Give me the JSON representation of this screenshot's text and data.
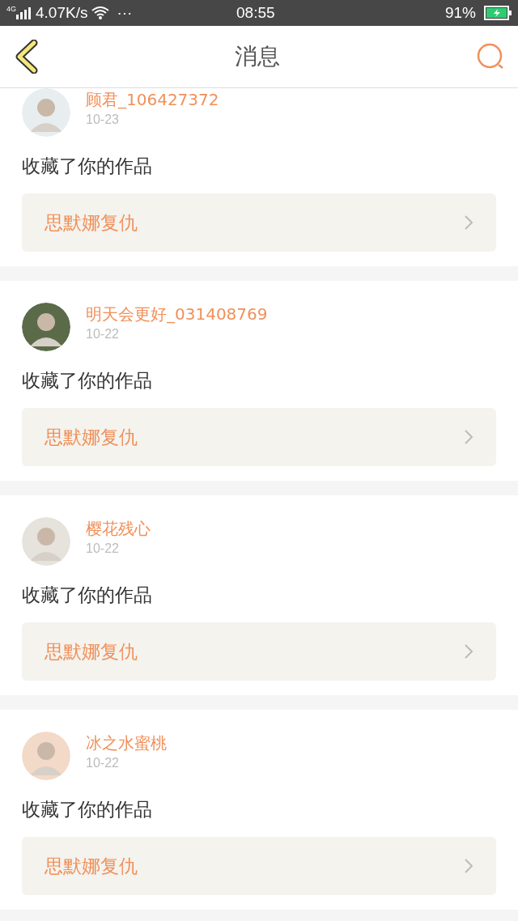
{
  "status_bar": {
    "network": "4G",
    "speed": "4.07K/s",
    "more": "···",
    "time": "08:55",
    "battery": "91%"
  },
  "header": {
    "title": "消息"
  },
  "messages": [
    {
      "user": "顾君_106427372",
      "date": "10-23",
      "action": "收藏了你的作品",
      "work": "思默娜复仇"
    },
    {
      "user": "明天会更好_031408769",
      "date": "10-22",
      "action": "收藏了你的作品",
      "work": "思默娜复仇"
    },
    {
      "user": "樱花残心",
      "date": "10-22",
      "action": "收藏了你的作品",
      "work": "思默娜复仇"
    },
    {
      "user": "冰之水蜜桃",
      "date": "10-22",
      "action": "收藏了你的作品",
      "work": "思默娜复仇"
    }
  ]
}
